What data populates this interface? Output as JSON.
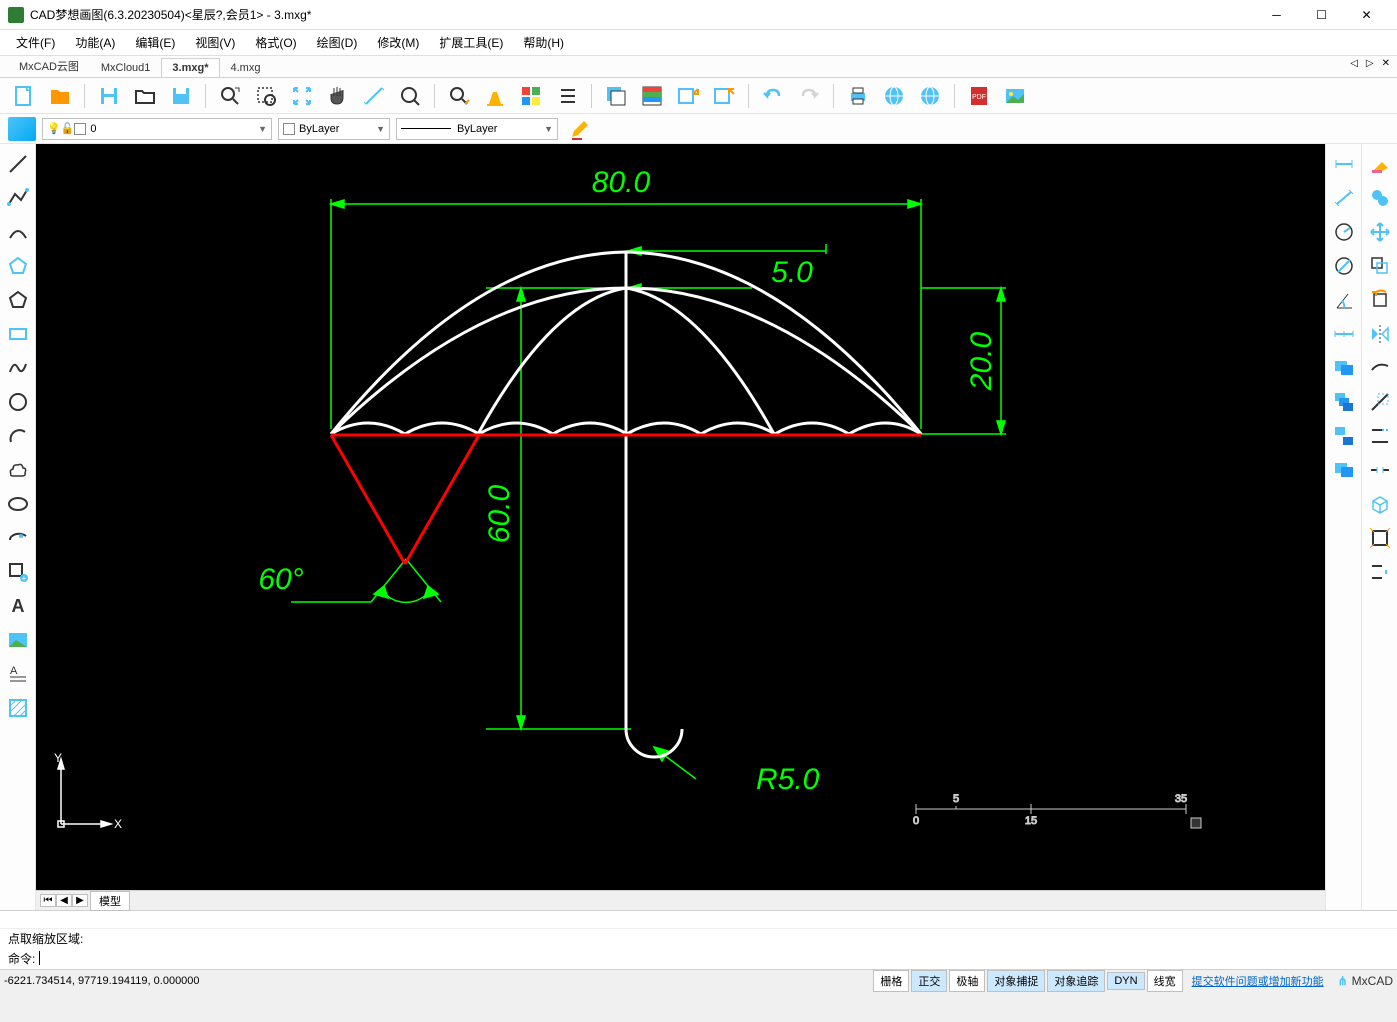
{
  "app": {
    "title": "CAD梦想画图(6.3.20230504)<星辰?,会员1> - 3.mxg*"
  },
  "menu": {
    "file": "文件(F)",
    "function": "功能(A)",
    "edit": "编辑(E)",
    "view": "视图(V)",
    "format": "格式(O)",
    "draw": "绘图(D)",
    "modify": "修改(M)",
    "extension": "扩展工具(E)",
    "help": "帮助(H)"
  },
  "tabs": {
    "t1": "MxCAD云图",
    "t2": "MxCloud1",
    "t3": "3.mxg*",
    "t4": "4.mxg"
  },
  "layer": {
    "current": "0",
    "color": "ByLayer",
    "linetype": "ByLayer"
  },
  "model_tab": "模型",
  "status": {
    "prompt": "点取缩放区域:",
    "cmd_label": "命令:",
    "coords": "-6221.734514,  97719.194119,  0.000000"
  },
  "statusbar": {
    "grid": "栅格",
    "ortho": "正交",
    "polar": "极轴",
    "osnap": "对象捕捉",
    "otrack": "对象追踪",
    "dyn": "DYN",
    "lweight": "线宽",
    "feedback": "提交软件问题或增加新功能",
    "brand": "MxCAD"
  },
  "dims": {
    "d80": "80.0",
    "d5": "5.0",
    "d20": "20.0",
    "d60v": "60.0",
    "ang60": "60°",
    "r5": "R5.0"
  },
  "ruler": {
    "r0": "0",
    "r5": "5",
    "r15": "15",
    "r35": "35"
  },
  "ucs": {
    "x": "X",
    "y": "Y"
  }
}
